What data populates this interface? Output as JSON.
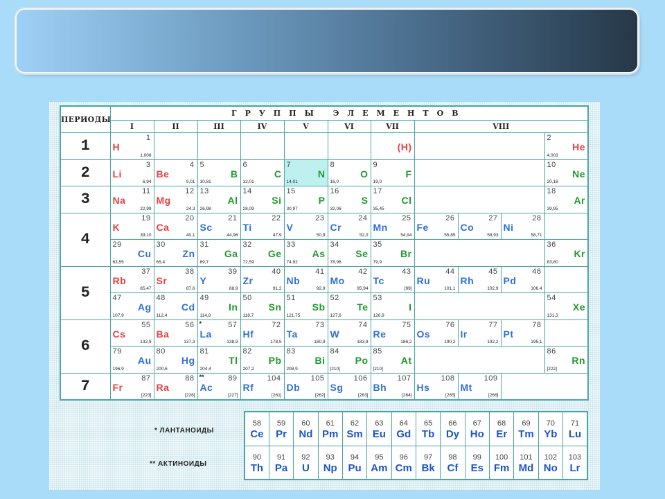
{
  "header": {
    "periods_label": "ПЕРИОДЫ",
    "groups_title": "ГРУППЫ  ЭЛЕМЕНТОВ",
    "roman": [
      "I",
      "II",
      "III",
      "IV",
      "V",
      "VI",
      "VII",
      "VIII"
    ]
  },
  "periods": [
    "1",
    "2",
    "3",
    "4",
    "5",
    "6",
    "7"
  ],
  "rows": [
    [
      {
        "sym": "H",
        "z": "1",
        "m": "1,008",
        "color": "red",
        "side": "L"
      },
      null,
      null,
      null,
      null,
      null,
      {
        "sym": "(H)",
        "z": "",
        "m": "",
        "color": "red",
        "side": "R"
      },
      null,
      {
        "sym": "He",
        "z": "2",
        "m": "4,003",
        "color": "red",
        "side": "R"
      }
    ],
    [
      {
        "sym": "Li",
        "z": "3",
        "m": "6,94",
        "color": "red",
        "side": "L"
      },
      {
        "sym": "Be",
        "z": "4",
        "m": "9,01",
        "color": "red",
        "side": "L"
      },
      {
        "sym": "B",
        "z": "5",
        "m": "10,81",
        "color": "green",
        "side": "R"
      },
      {
        "sym": "C",
        "z": "6",
        "m": "12,01",
        "color": "green",
        "side": "R"
      },
      {
        "sym": "N",
        "z": "7",
        "m": "14,01",
        "color": "green",
        "side": "R",
        "hl": true
      },
      {
        "sym": "O",
        "z": "8",
        "m": "16,0",
        "color": "green",
        "side": "R"
      },
      {
        "sym": "F",
        "z": "9",
        "m": "19,0",
        "color": "green",
        "side": "R"
      },
      null,
      {
        "sym": "Ne",
        "z": "10",
        "m": "20,18",
        "color": "green",
        "side": "R"
      }
    ],
    [
      {
        "sym": "Na",
        "z": "11",
        "m": "22,99",
        "color": "red",
        "side": "L"
      },
      {
        "sym": "Mg",
        "z": "12",
        "m": "24,3",
        "color": "red",
        "side": "L"
      },
      {
        "sym": "Al",
        "z": "13",
        "m": "26,98",
        "color": "green",
        "side": "R"
      },
      {
        "sym": "Si",
        "z": "14",
        "m": "28,09",
        "color": "green",
        "side": "R"
      },
      {
        "sym": "P",
        "z": "15",
        "m": "30,97",
        "color": "green",
        "side": "R"
      },
      {
        "sym": "S",
        "z": "16",
        "m": "32,06",
        "color": "green",
        "side": "R"
      },
      {
        "sym": "Cl",
        "z": "17",
        "m": "35,45",
        "color": "green",
        "side": "R"
      },
      null,
      {
        "sym": "Ar",
        "z": "18",
        "m": "39,95",
        "color": "green",
        "side": "R"
      }
    ],
    [
      {
        "sym": "K",
        "z": "19",
        "m": "39,10",
        "color": "red",
        "side": "L"
      },
      {
        "sym": "Ca",
        "z": "20",
        "m": "40,1",
        "color": "red",
        "side": "L"
      },
      {
        "sym": "Sc",
        "z": "21",
        "m": "44,96",
        "color": "blue",
        "side": "L"
      },
      {
        "sym": "Ti",
        "z": "22",
        "m": "47,9",
        "color": "blue",
        "side": "L"
      },
      {
        "sym": "V",
        "z": "23",
        "m": "50,9",
        "color": "blue",
        "side": "L"
      },
      {
        "sym": "Cr",
        "z": "24",
        "m": "52,0",
        "color": "blue",
        "side": "L"
      },
      {
        "sym": "Mn",
        "z": "25",
        "m": "54,94",
        "color": "blue",
        "side": "L"
      },
      {
        "sym": "Fe",
        "z": "26",
        "m": "55,85",
        "color": "blue",
        "side": "L"
      },
      {
        "sym": "Co",
        "z": "27",
        "m": "58,93",
        "color": "blue",
        "side": "L"
      },
      {
        "sym": "Ni",
        "z": "28",
        "m": "58,71",
        "color": "blue",
        "side": "L"
      }
    ],
    [
      {
        "sym": "Cu",
        "z": "29",
        "m": "63,55",
        "color": "blue",
        "side": "R"
      },
      {
        "sym": "Zn",
        "z": "30",
        "m": "65,4",
        "color": "blue",
        "side": "R"
      },
      {
        "sym": "Ga",
        "z": "31",
        "m": "69,7",
        "color": "green",
        "side": "R"
      },
      {
        "sym": "Ge",
        "z": "32",
        "m": "72,59",
        "color": "green",
        "side": "R"
      },
      {
        "sym": "As",
        "z": "33",
        "m": "74,92",
        "color": "green",
        "side": "R"
      },
      {
        "sym": "Se",
        "z": "34",
        "m": "78,96",
        "color": "green",
        "side": "R"
      },
      {
        "sym": "Br",
        "z": "35",
        "m": "79,9",
        "color": "green",
        "side": "R"
      },
      null,
      {
        "sym": "Kr",
        "z": "36",
        "m": "83,80",
        "color": "green",
        "side": "R"
      }
    ],
    [
      {
        "sym": "Rb",
        "z": "37",
        "m": "85,47",
        "color": "red",
        "side": "L"
      },
      {
        "sym": "Sr",
        "z": "38",
        "m": "87,6",
        "color": "red",
        "side": "L"
      },
      {
        "sym": "Y",
        "z": "39",
        "m": "88,9",
        "color": "blue",
        "side": "L"
      },
      {
        "sym": "Zr",
        "z": "40",
        "m": "91,2",
        "color": "blue",
        "side": "L"
      },
      {
        "sym": "Nb",
        "z": "41",
        "m": "92,9",
        "color": "blue",
        "side": "L"
      },
      {
        "sym": "Mo",
        "z": "42",
        "m": "95,94",
        "color": "blue",
        "side": "L"
      },
      {
        "sym": "Tc",
        "z": "43",
        "m": "[99]",
        "color": "blue",
        "side": "L"
      },
      {
        "sym": "Ru",
        "z": "44",
        "m": "101,1",
        "color": "blue",
        "side": "L"
      },
      {
        "sym": "Rh",
        "z": "45",
        "m": "102,9",
        "color": "blue",
        "side": "L"
      },
      {
        "sym": "Pd",
        "z": "46",
        "m": "106,4",
        "color": "blue",
        "side": "L"
      }
    ],
    [
      {
        "sym": "Ag",
        "z": "47",
        "m": "107,9",
        "color": "blue",
        "side": "R"
      },
      {
        "sym": "Cd",
        "z": "48",
        "m": "112,4",
        "color": "blue",
        "side": "R"
      },
      {
        "sym": "In",
        "z": "49",
        "m": "114,8",
        "color": "green",
        "side": "R"
      },
      {
        "sym": "Sn",
        "z": "50",
        "m": "118,7",
        "color": "green",
        "side": "R"
      },
      {
        "sym": "Sb",
        "z": "51",
        "m": "121,75",
        "color": "green",
        "side": "R"
      },
      {
        "sym": "Te",
        "z": "52",
        "m": "127,6",
        "color": "green",
        "side": "R"
      },
      {
        "sym": "I",
        "z": "53",
        "m": "126,9",
        "color": "green",
        "side": "R"
      },
      null,
      {
        "sym": "Xe",
        "z": "54",
        "m": "131,3",
        "color": "green",
        "side": "R"
      }
    ],
    [
      {
        "sym": "Cs",
        "z": "55",
        "m": "132,9",
        "color": "red",
        "side": "L"
      },
      {
        "sym": "Ba",
        "z": "56",
        "m": "137,3",
        "color": "red",
        "side": "L"
      },
      {
        "sym": "La",
        "z": "57",
        "m": "138,9",
        "color": "blue",
        "side": "L",
        "star": "*"
      },
      {
        "sym": "Hf",
        "z": "72",
        "m": "178,5",
        "color": "blue",
        "side": "L"
      },
      {
        "sym": "Ta",
        "z": "73",
        "m": "180,9",
        "color": "blue",
        "side": "L"
      },
      {
        "sym": "W",
        "z": "74",
        "m": "183,8",
        "color": "blue",
        "side": "L"
      },
      {
        "sym": "Re",
        "z": "75",
        "m": "186,2",
        "color": "blue",
        "side": "L"
      },
      {
        "sym": "Os",
        "z": "76",
        "m": "190,2",
        "color": "blue",
        "side": "L"
      },
      {
        "sym": "Ir",
        "z": "77",
        "m": "192,2",
        "color": "blue",
        "side": "L"
      },
      {
        "sym": "Pt",
        "z": "78",
        "m": "195,1",
        "color": "blue",
        "side": "L"
      }
    ],
    [
      {
        "sym": "Au",
        "z": "79",
        "m": "196,9",
        "color": "blue",
        "side": "R"
      },
      {
        "sym": "Hg",
        "z": "80",
        "m": "200,6",
        "color": "blue",
        "side": "R"
      },
      {
        "sym": "Tl",
        "z": "81",
        "m": "204,4",
        "color": "green",
        "side": "R"
      },
      {
        "sym": "Pb",
        "z": "82",
        "m": "207,2",
        "color": "green",
        "side": "R"
      },
      {
        "sym": "Bi",
        "z": "83",
        "m": "208,9",
        "color": "green",
        "side": "R"
      },
      {
        "sym": "Po",
        "z": "84",
        "m": "[210]",
        "color": "green",
        "side": "R"
      },
      {
        "sym": "At",
        "z": "85",
        "m": "[210]",
        "color": "green",
        "side": "R"
      },
      null,
      {
        "sym": "Rn",
        "z": "86",
        "m": "[222]",
        "color": "green",
        "side": "R"
      }
    ],
    [
      {
        "sym": "Fr",
        "z": "87",
        "m": "[223]",
        "color": "red",
        "side": "L"
      },
      {
        "sym": "Ra",
        "z": "88",
        "m": "[226]",
        "color": "red",
        "side": "L"
      },
      {
        "sym": "Ac",
        "z": "89",
        "m": "[227]",
        "color": "blue",
        "side": "L",
        "star": "**"
      },
      {
        "sym": "Rf",
        "z": "104",
        "m": "[261]",
        "color": "blue",
        "side": "L"
      },
      {
        "sym": "Db",
        "z": "105",
        "m": "[262]",
        "color": "blue",
        "side": "L"
      },
      {
        "sym": "Sg",
        "z": "106",
        "m": "[263]",
        "color": "blue",
        "side": "L"
      },
      {
        "sym": "Bh",
        "z": "107",
        "m": "[264]",
        "color": "blue",
        "side": "L"
      },
      {
        "sym": "Hs",
        "z": "108",
        "m": "[265]",
        "color": "blue",
        "side": "L"
      },
      {
        "sym": "Mt",
        "z": "109",
        "m": "[266]",
        "color": "blue",
        "side": "L"
      }
    ]
  ],
  "series": {
    "lanthanides_label": "* ЛАНТАНОИДЫ",
    "actinides_label": "** АКТИНОИДЫ",
    "lanthanides": [
      {
        "z": "58",
        "sym": "Ce"
      },
      {
        "z": "59",
        "sym": "Pr"
      },
      {
        "z": "60",
        "sym": "Nd"
      },
      {
        "z": "61",
        "sym": "Pm"
      },
      {
        "z": "62",
        "sym": "Sm"
      },
      {
        "z": "63",
        "sym": "Eu"
      },
      {
        "z": "64",
        "sym": "Gd"
      },
      {
        "z": "65",
        "sym": "Tb"
      },
      {
        "z": "66",
        "sym": "Dy"
      },
      {
        "z": "67",
        "sym": "Ho"
      },
      {
        "z": "68",
        "sym": "Er"
      },
      {
        "z": "69",
        "sym": "Tm"
      },
      {
        "z": "70",
        "sym": "Yb"
      },
      {
        "z": "71",
        "sym": "Lu"
      }
    ],
    "actinides": [
      {
        "z": "90",
        "sym": "Th"
      },
      {
        "z": "91",
        "sym": "Pa"
      },
      {
        "z": "92",
        "sym": "U"
      },
      {
        "z": "93",
        "sym": "Np"
      },
      {
        "z": "94",
        "sym": "Pu"
      },
      {
        "z": "95",
        "sym": "Am"
      },
      {
        "z": "96",
        "sym": "Cm"
      },
      {
        "z": "97",
        "sym": "Bk"
      },
      {
        "z": "98",
        "sym": "Cf"
      },
      {
        "z": "99",
        "sym": "Es"
      },
      {
        "z": "100",
        "sym": "Fm"
      },
      {
        "z": "101",
        "sym": "Md"
      },
      {
        "z": "102",
        "sym": "No"
      },
      {
        "z": "103",
        "sym": "Lr"
      }
    ]
  }
}
